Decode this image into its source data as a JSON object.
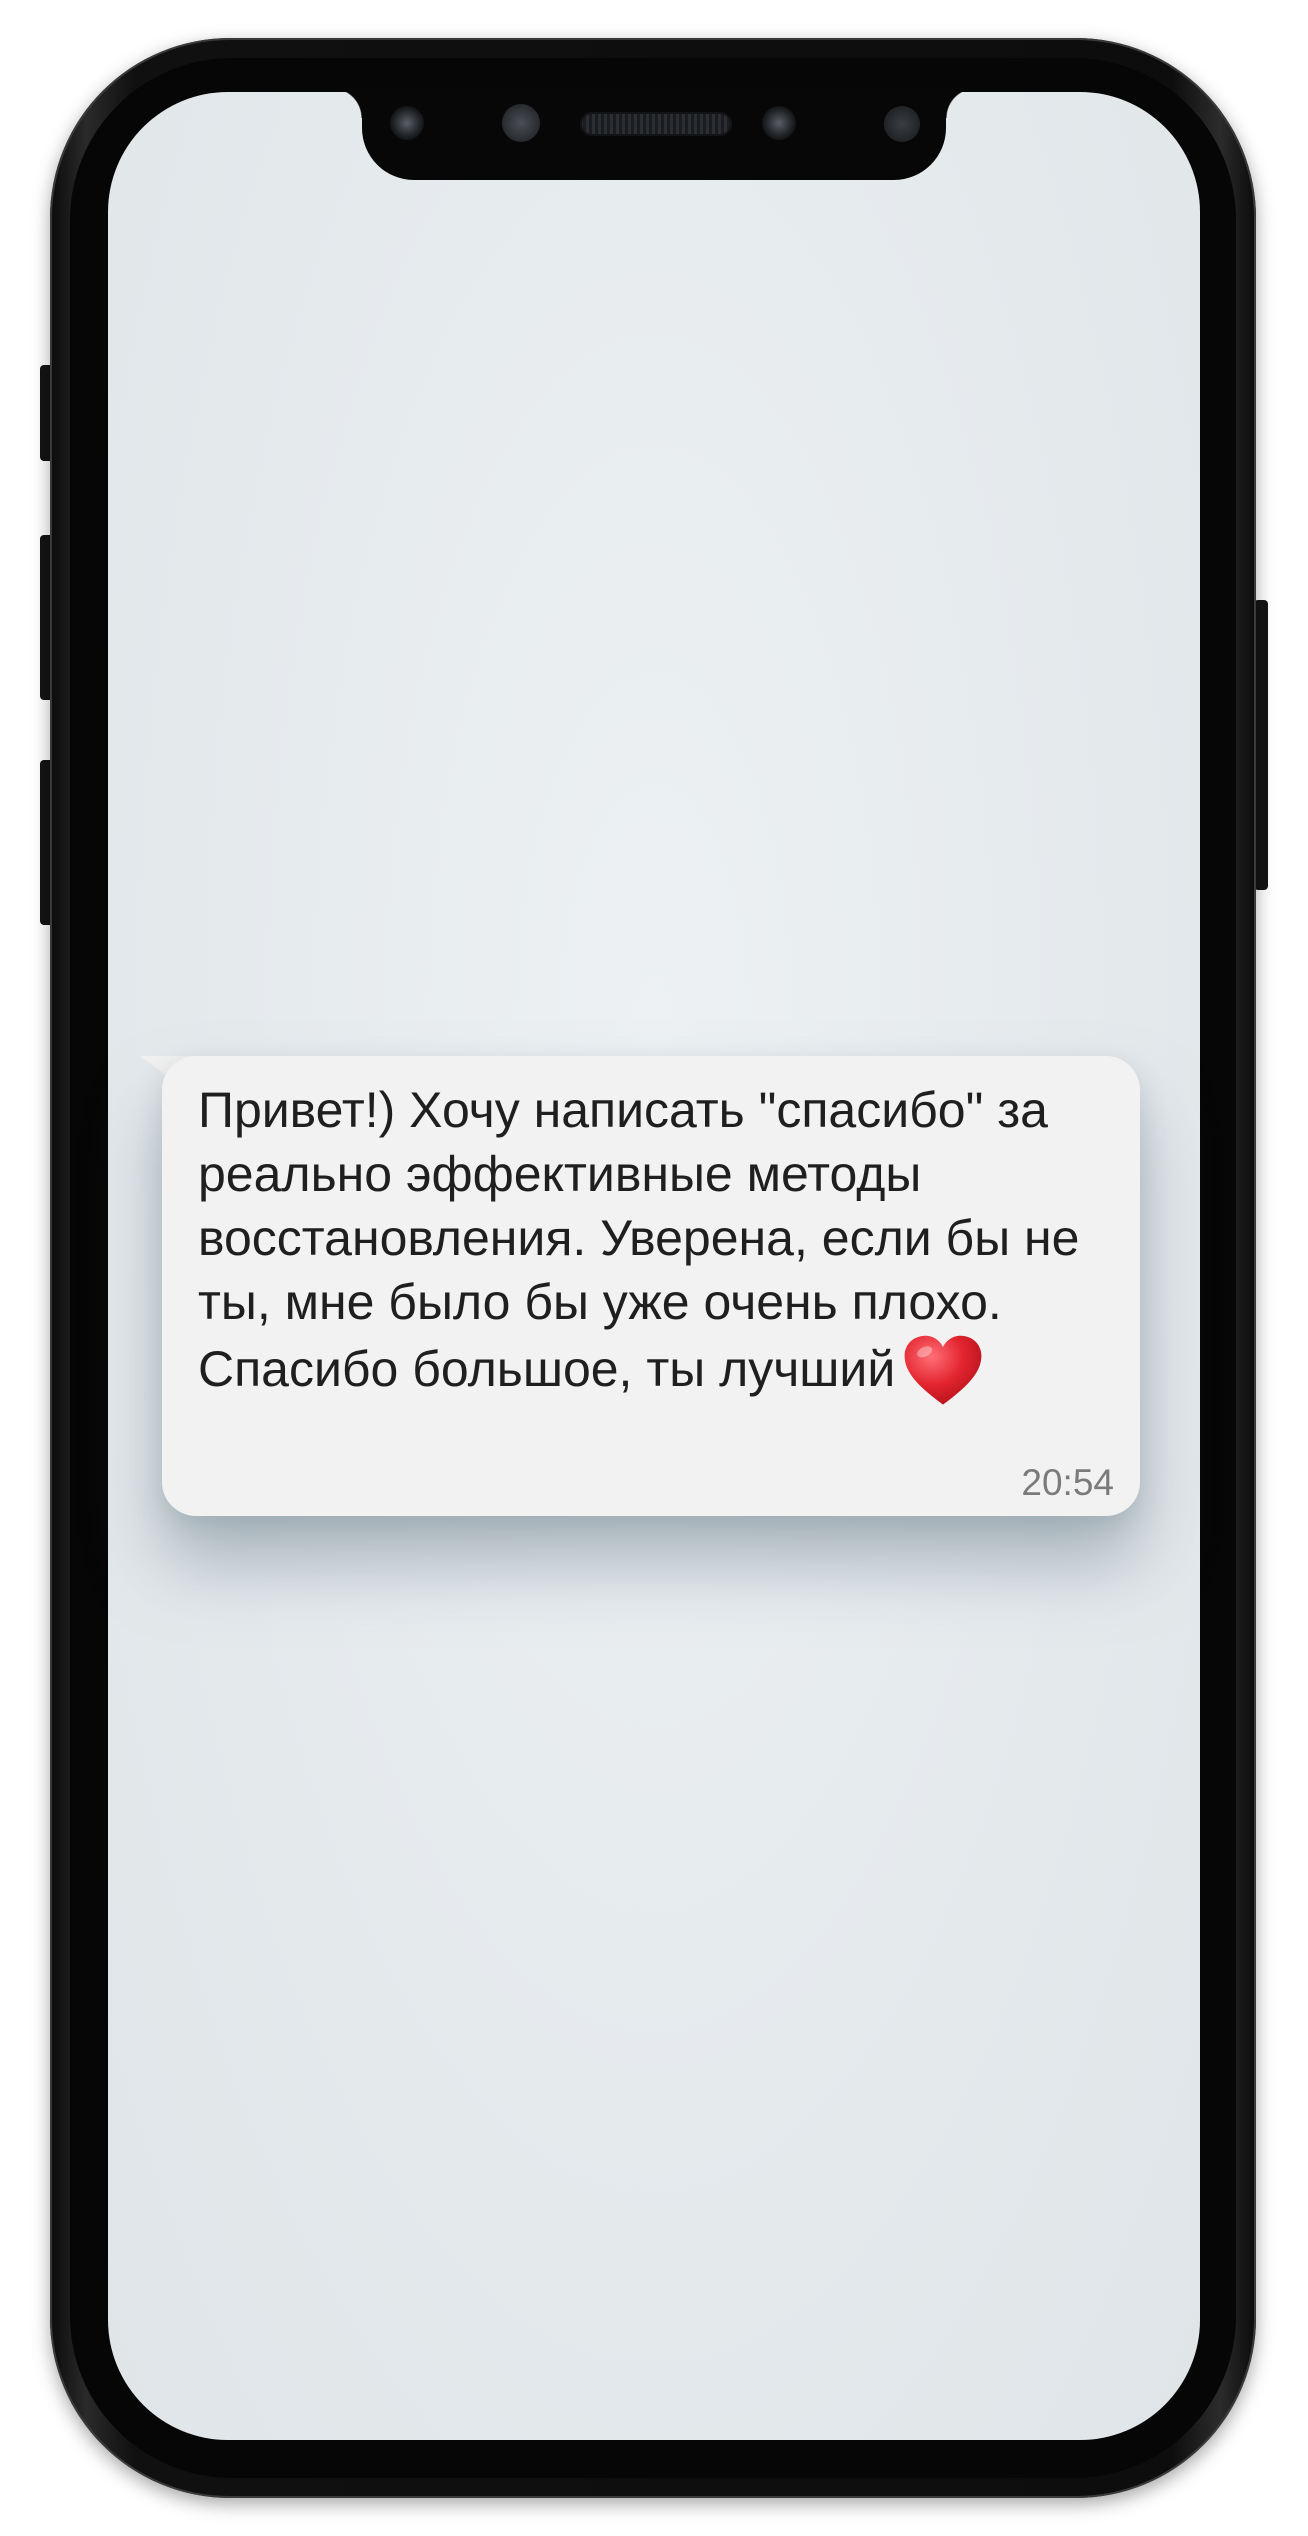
{
  "message": {
    "text": "Привет!) Хочу написать \"спасибо\" за реально эффективные методы восстановления. Уверена, если бы не ты, мне было бы уже очень плохо. Спасибо большое, ты лучший",
    "emoji_icon": "red-heart-icon",
    "time": "20:54",
    "bubble_color": "#f2f2f2",
    "text_color": "#1f1f1f",
    "time_color": "#7b7b7b"
  },
  "screen": {
    "background_color": "#e7ecee"
  },
  "device": {
    "frame_color": "#0d0d0d"
  }
}
